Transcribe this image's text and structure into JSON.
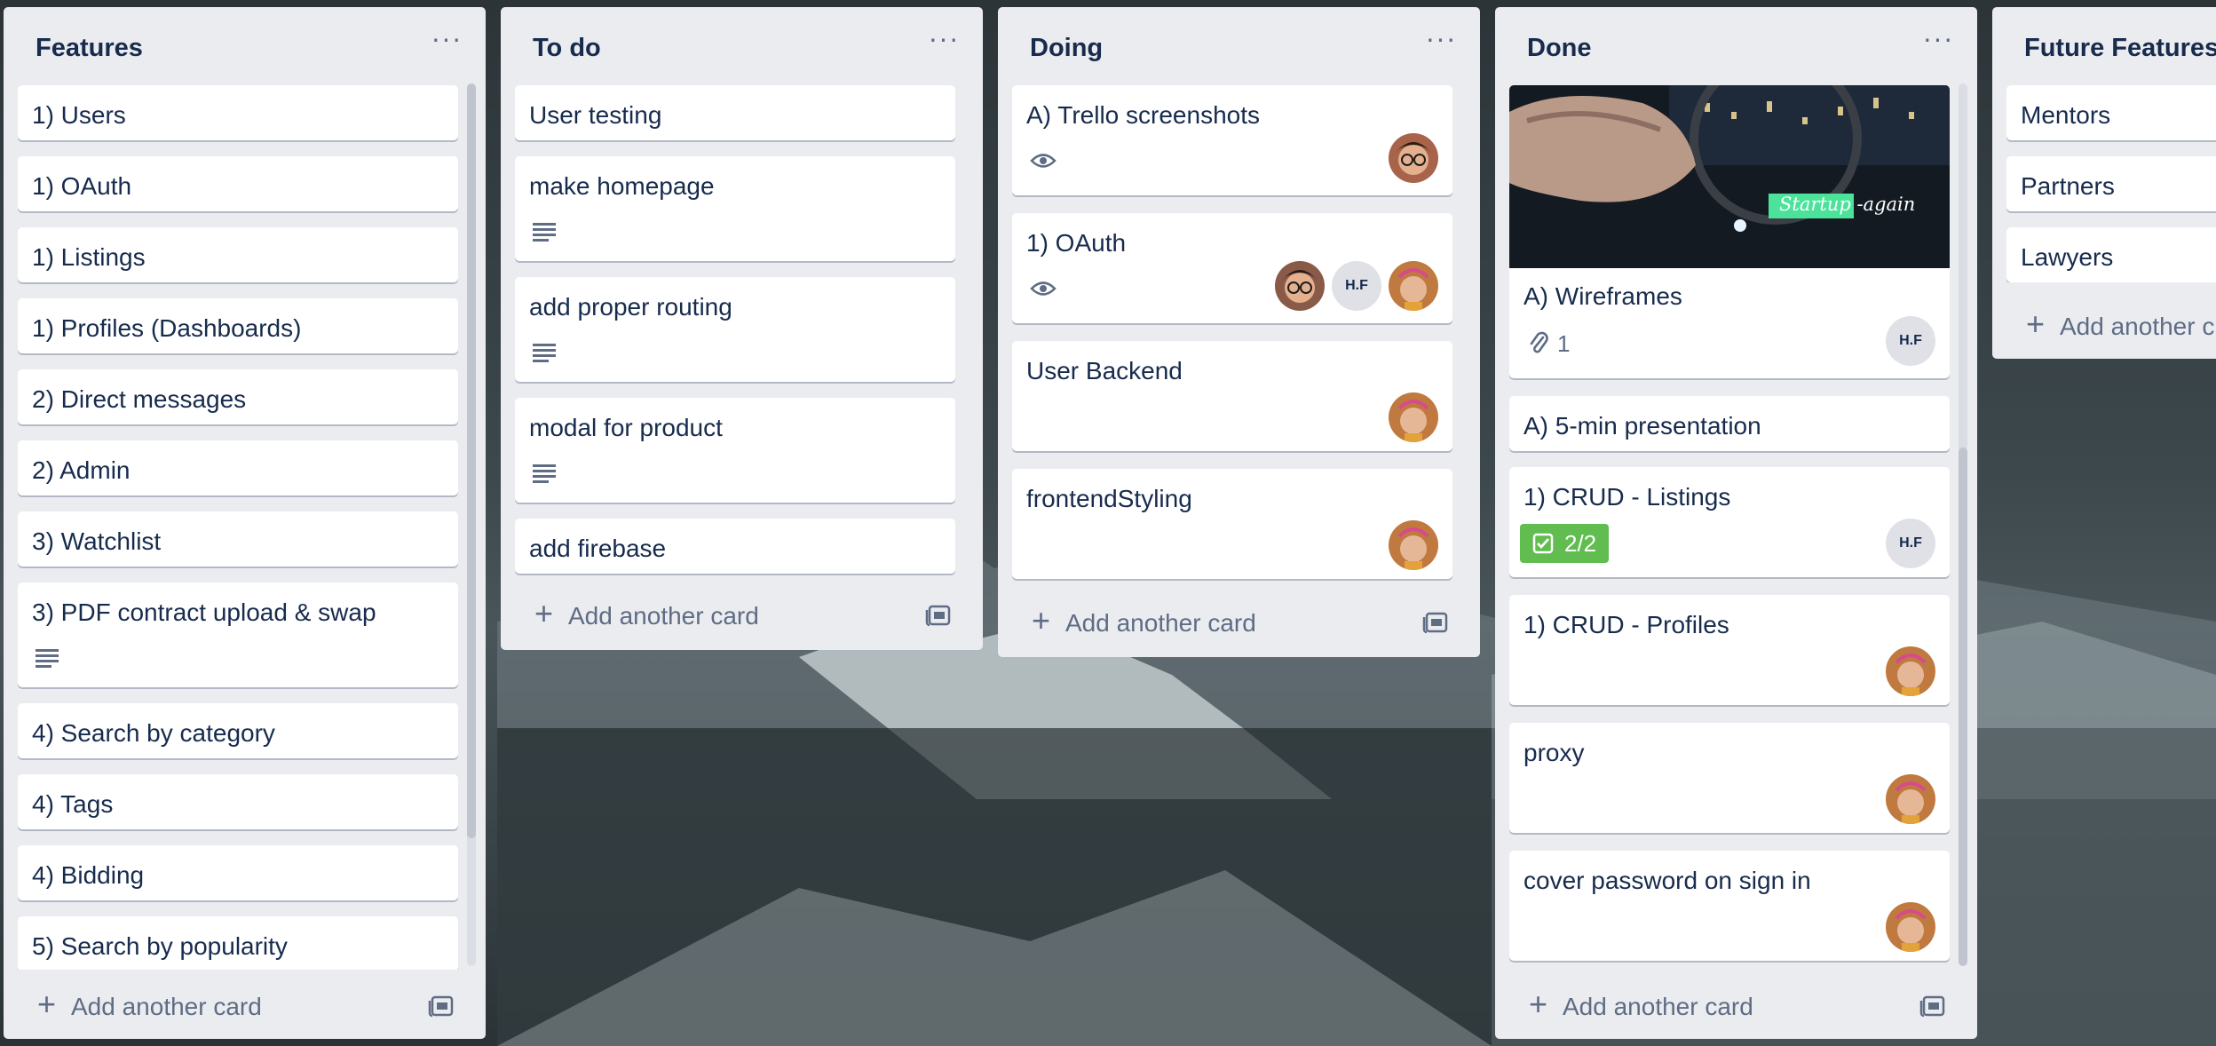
{
  "board": {
    "lists": [
      {
        "title": "Features",
        "cards": [
          "1) Users",
          "1) OAuth",
          "1) Listings",
          "1) Profiles (Dashboards)",
          "2) Direct messages",
          "2) Admin",
          "3) Watchlist",
          "3) PDF contract upload & swap",
          "4) Search by category",
          "4) Tags",
          "4) Bidding",
          "5) Search by popularity"
        ],
        "add_label": "Add another card"
      },
      {
        "title": "To do",
        "cards": [
          "User testing",
          "make homepage",
          "add proper routing",
          "modal for product",
          "add firebase"
        ],
        "add_label": "Add another card"
      },
      {
        "title": "Doing",
        "cards": [
          "A) Trello screenshots",
          "1) OAuth",
          "User Backend",
          "frontendStyling"
        ],
        "add_label": "Add another card",
        "initials": "H.F"
      },
      {
        "title": "Done",
        "cover_text": "Startup -again",
        "cards": [
          "A) Wireframes",
          "A) 5-min presentation",
          "1) CRUD - Listings",
          "1) CRUD - Profiles",
          "proxy",
          "cover password on sign in"
        ],
        "attachment_count": "1",
        "checklist": "2/2",
        "initials": "H.F",
        "add_label": "Add another card"
      },
      {
        "title": "Future Features",
        "cards": [
          "Mentors",
          "Partners",
          "Lawyers"
        ],
        "add_label": "Add another c"
      }
    ]
  },
  "colors": {
    "list_bg": "#ebecf0",
    "card_bg": "#ffffff",
    "text": "#172b4d",
    "muted": "#5e6c84",
    "label_green": "#61bd4f"
  },
  "icons": [
    "menu-dots-icon",
    "description-icon",
    "eye-icon",
    "plus-icon",
    "template-icon",
    "attachment-icon",
    "checklist-icon"
  ]
}
